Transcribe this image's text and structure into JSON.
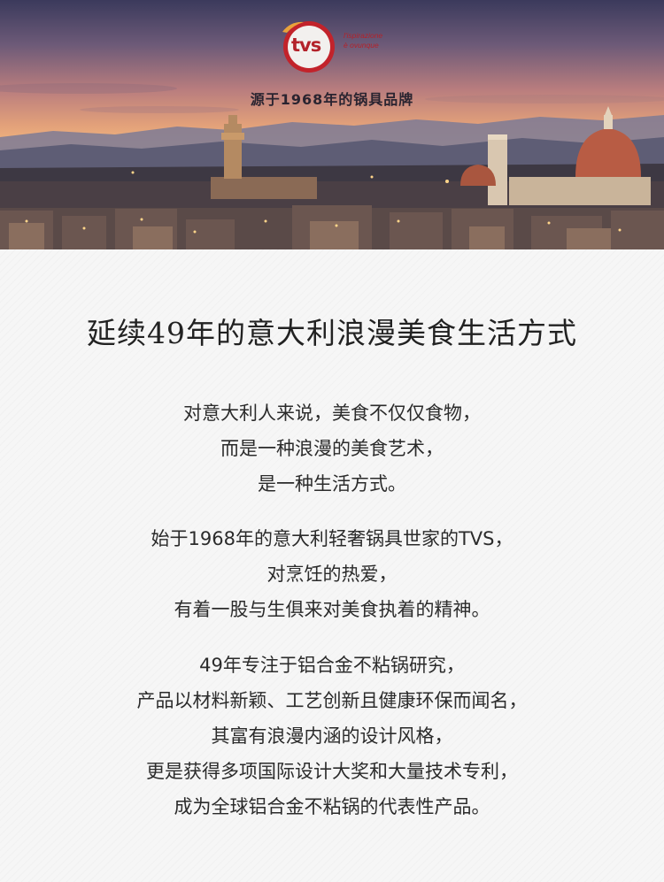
{
  "brand": {
    "logo_text": "tvs",
    "tagline": [
      "l'ispirazione",
      "è ovunque"
    ],
    "brand_color": "#c2232b"
  },
  "hero": {
    "subtitle": "源于1968年的锅具品牌"
  },
  "main": {
    "title": "延续49年的意大利浪漫美食生活方式",
    "paragraphs": [
      [
        "对意大利人来说，美食不仅仅食物，",
        "而是一种浪漫的美食艺术，",
        "是一种生活方式。"
      ],
      [
        "始于1968年的意大利轻奢锅具世家的TVS，",
        "对烹饪的热爱，",
        "有着一股与生俱来对美食执着的精神。"
      ],
      [
        "49年专注于铝合金不粘锅研究，",
        "产品以材料新颖、工艺创新且健康环保而闻名，",
        "其富有浪漫内涵的设计风格，",
        "更是获得多项国际设计大奖和大量技术专利，",
        "成为全球铝合金不粘锅的代表性产品。"
      ]
    ]
  }
}
